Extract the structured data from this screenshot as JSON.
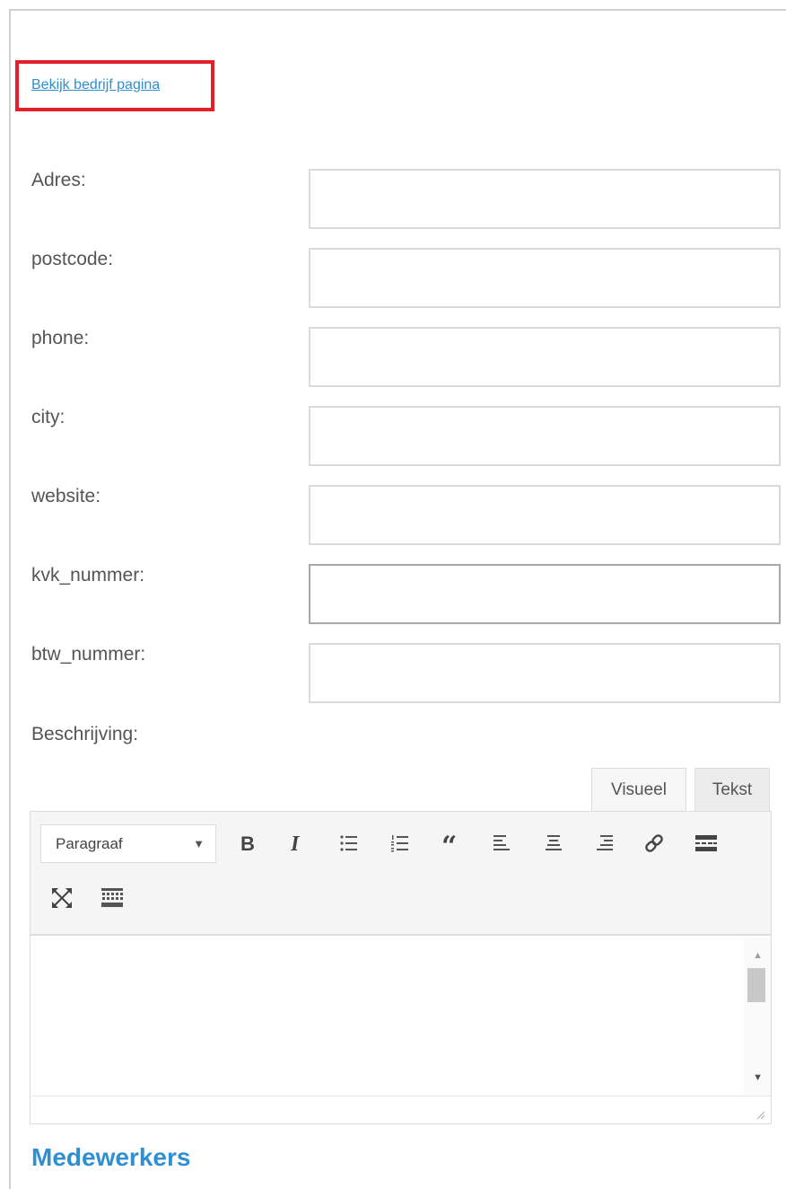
{
  "company_link": {
    "label": "Bekijk bedrijf pagina"
  },
  "fields": [
    {
      "label": "Adres:",
      "value": ""
    },
    {
      "label": "postcode:",
      "value": ""
    },
    {
      "label": "phone:",
      "value": ""
    },
    {
      "label": "city:",
      "value": ""
    },
    {
      "label": "website:",
      "value": ""
    },
    {
      "label": "kvk_nummer:",
      "value": ""
    },
    {
      "label": "btw_nummer:",
      "value": ""
    }
  ],
  "description": {
    "label": "Beschrijving:",
    "tabs": {
      "visual": "Visueel",
      "text": "Tekst"
    },
    "format_select": {
      "selected": "Paragraaf"
    },
    "toolbar_icons": [
      "bold-icon",
      "italic-icon",
      "bullet-list-icon",
      "numbered-list-icon",
      "blockquote-icon",
      "align-left-icon",
      "align-center-icon",
      "align-right-icon",
      "link-icon",
      "read-more-icon",
      "fullscreen-icon",
      "toolbar-toggle-icon"
    ],
    "content": ""
  },
  "section_title": "Medewerkers",
  "colors": {
    "link": "#2c8fcf",
    "highlight_border": "#e3202a",
    "section_title": "#2f8fd1",
    "label": "#555555"
  }
}
